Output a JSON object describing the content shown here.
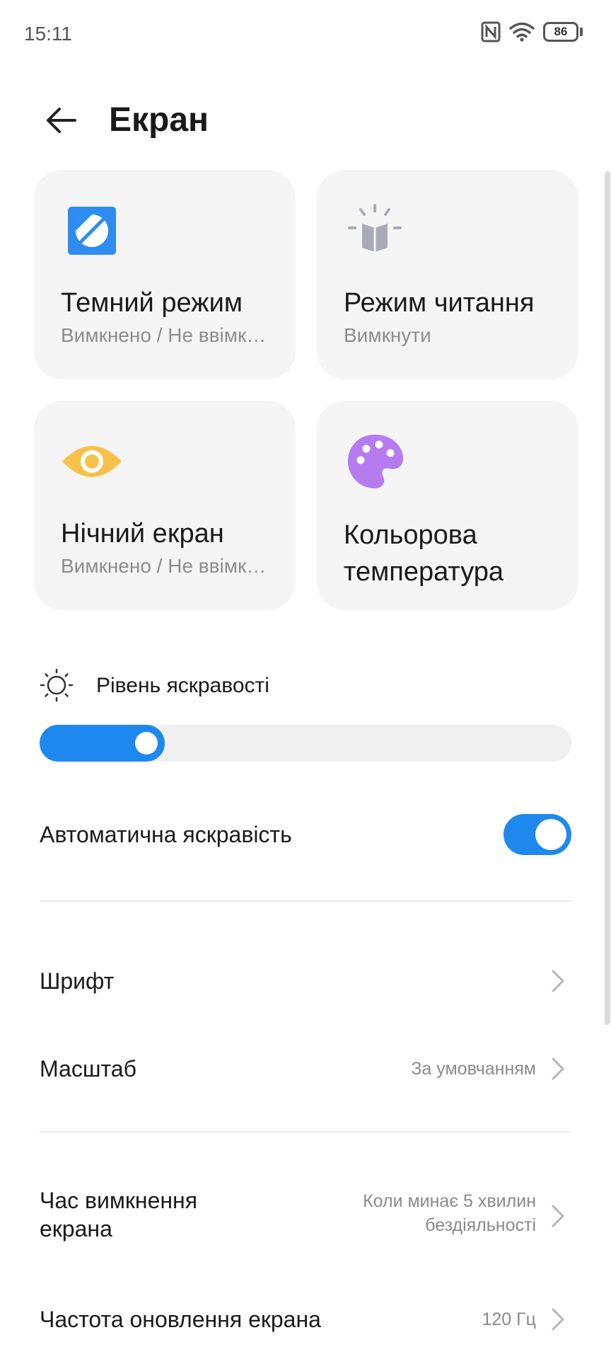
{
  "status_bar": {
    "time": "15:11",
    "battery": "86",
    "icons": [
      "nfc-icon",
      "wifi-icon",
      "battery-icon"
    ]
  },
  "header": {
    "title": "Екран",
    "back_icon": "arrow-left-icon"
  },
  "cards": [
    {
      "title": "Темний режим",
      "subtitle": "Вимкнено / Не ввімк…",
      "icon": "dark-mode-icon",
      "icon_color": "#2f8cf0"
    },
    {
      "title": "Режим читання",
      "subtitle": "Вимкнути",
      "icon": "reading-lamp-icon",
      "icon_color": "#a9aab5"
    },
    {
      "title": "Нічний екран",
      "subtitle": "Вимкнено / Не ввімк…",
      "icon": "eye-icon",
      "icon_color": "#f8c24a"
    },
    {
      "title_line1": "Кольорова",
      "title_line2": "температура",
      "icon": "palette-icon",
      "icon_color": "#b57bef"
    }
  ],
  "brightness": {
    "label": "Рівень яскравості",
    "icon": "sun-icon",
    "level": 0.235
  },
  "auto_brightness": {
    "label": "Автоматична яскравість",
    "enabled": true
  },
  "items": {
    "font": {
      "label": "Шрифт"
    },
    "scale": {
      "label": "Масштаб",
      "value": "За умовчанням"
    },
    "screen_timeout": {
      "label_line1": "Час вимкнення",
      "label_line2": "екрана",
      "value_line1": "Коли минає 5 хвилин",
      "value_line2": "бездіяльності"
    },
    "refresh_rate": {
      "label": "Частота оновлення екрана",
      "value": "120 Гц"
    }
  },
  "colors": {
    "accent": "#1e88ef",
    "card_bg": "#f5f5f5",
    "secondary_text": "#8c8c8c"
  }
}
